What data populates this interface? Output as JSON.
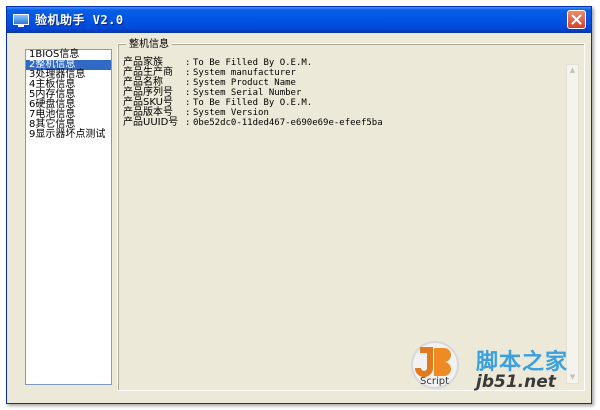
{
  "window": {
    "title": "验机助手 V2.0",
    "colors": {
      "titlebar": "#0055e5",
      "face": "#ece9d8",
      "selection": "#316ac5",
      "close": "#d2412a"
    }
  },
  "nav": {
    "items": [
      {
        "label": "1BIOS信息",
        "selected": false
      },
      {
        "label": "2整机信息",
        "selected": true
      },
      {
        "label": "3处理器信息",
        "selected": false
      },
      {
        "label": "4主板信息",
        "selected": false
      },
      {
        "label": "5内存信息",
        "selected": false
      },
      {
        "label": "6硬盘信息",
        "selected": false
      },
      {
        "label": "7电池信息",
        "selected": false
      },
      {
        "label": "8其它信息",
        "selected": false
      },
      {
        "label": "9显示器坏点测试",
        "selected": false
      }
    ]
  },
  "panel": {
    "title": "整机信息",
    "rows": [
      {
        "label": "产品家族",
        "value": "To Be Filled By O.E.M."
      },
      {
        "label": "产品生产商",
        "value": "System manufacturer"
      },
      {
        "label": "产品名称",
        "value": "System Product Name"
      },
      {
        "label": "产品序列号",
        "value": "System Serial Number"
      },
      {
        "label": "产品SKU号",
        "value": "To Be Filled By O.E.M."
      },
      {
        "label": "产品版本号",
        "value": "System Version"
      },
      {
        "label": "产品UUID号",
        "value": "0be52dc0-11ded467-e690e69e-efeef5ba"
      }
    ],
    "separator": ":"
  },
  "watermark": {
    "script_label": "Script",
    "site_cn": "脚本之家",
    "site_url": "jb51.net"
  }
}
